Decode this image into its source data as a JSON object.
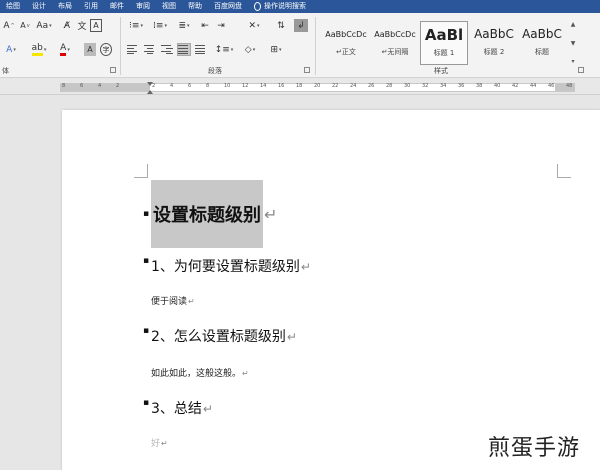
{
  "menubar": {
    "items": [
      "绘图",
      "设计",
      "布局",
      "引用",
      "邮件",
      "审阅",
      "视图",
      "帮助",
      "百度网盘"
    ],
    "tell_me": "操作说明搜索"
  },
  "ribbon": {
    "groups": {
      "font_partial": "体",
      "paragraph": "段落",
      "styles": "样式"
    },
    "styles": [
      {
        "preview": "AaBbCcDc",
        "name": "↵正文"
      },
      {
        "preview": "AaBbCcDc",
        "name": "↵无间隔"
      },
      {
        "preview": "AaBl",
        "name": "标题 1"
      },
      {
        "preview": "AaBbC",
        "name": "标题 2"
      },
      {
        "preview": "AaBbC",
        "name": "标题"
      }
    ]
  },
  "ruler": {
    "ticks": [
      "8",
      "6",
      "4",
      "2",
      "",
      "2",
      "4",
      "6",
      "8",
      "10",
      "12",
      "14",
      "16",
      "18",
      "20",
      "22",
      "24",
      "26",
      "28",
      "30",
      "32",
      "34",
      "36",
      "38",
      "40",
      "42",
      "44",
      "46",
      "48"
    ]
  },
  "document": {
    "h1": "设置标题级别",
    "sec1_heading": "1、为何要设置标题级别",
    "sec1_body": "便于阅读",
    "sec2_heading": "2、怎么设置标题级别",
    "sec2_body": "如此如此，这般这般。",
    "sec3_heading": "3、总结",
    "sec3_body": "好",
    "para_mark": "↵"
  },
  "watermark": "煎蛋手游"
}
